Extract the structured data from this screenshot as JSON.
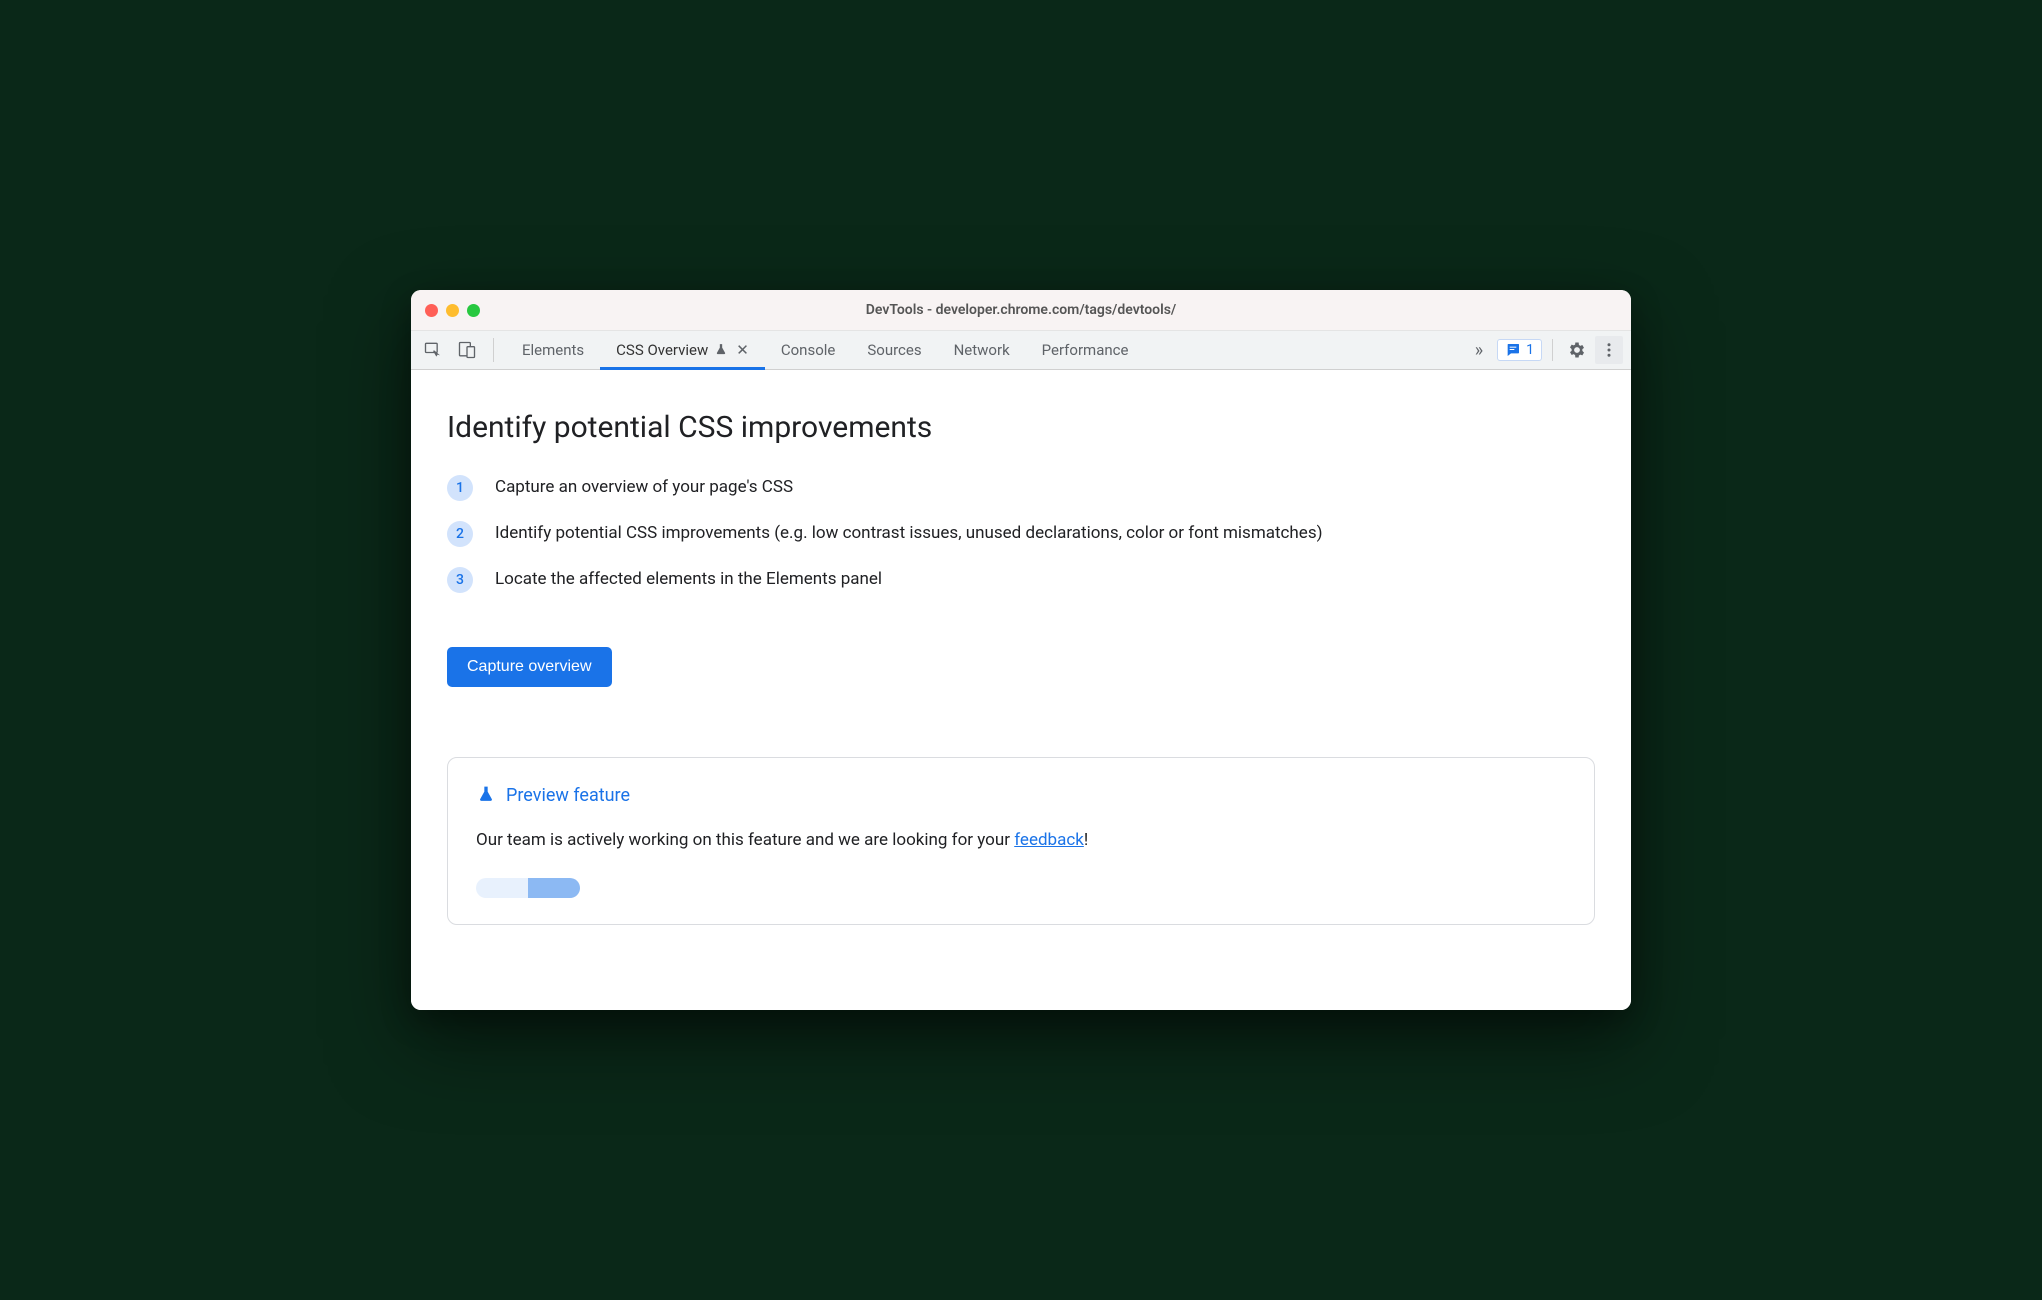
{
  "window": {
    "title": "DevTools - developer.chrome.com/tags/devtools/"
  },
  "tabs": {
    "elements": "Elements",
    "css_overview": "CSS Overview",
    "console": "Console",
    "sources": "Sources",
    "network": "Network",
    "performance": "Performance"
  },
  "issues": {
    "count": "1"
  },
  "main": {
    "title": "Identify potential CSS improvements",
    "steps": [
      "Capture an overview of your page's CSS",
      "Identify potential CSS improvements (e.g. low contrast issues, unused declarations, color or font mismatches)",
      "Locate the affected elements in the Elements panel"
    ],
    "step_nums": [
      "1",
      "2",
      "3"
    ],
    "capture_btn": "Capture overview"
  },
  "preview": {
    "label": "Preview feature",
    "text_before": "Our team is actively working on this feature and we are looking for your ",
    "link": "feedback",
    "text_after": "!"
  }
}
